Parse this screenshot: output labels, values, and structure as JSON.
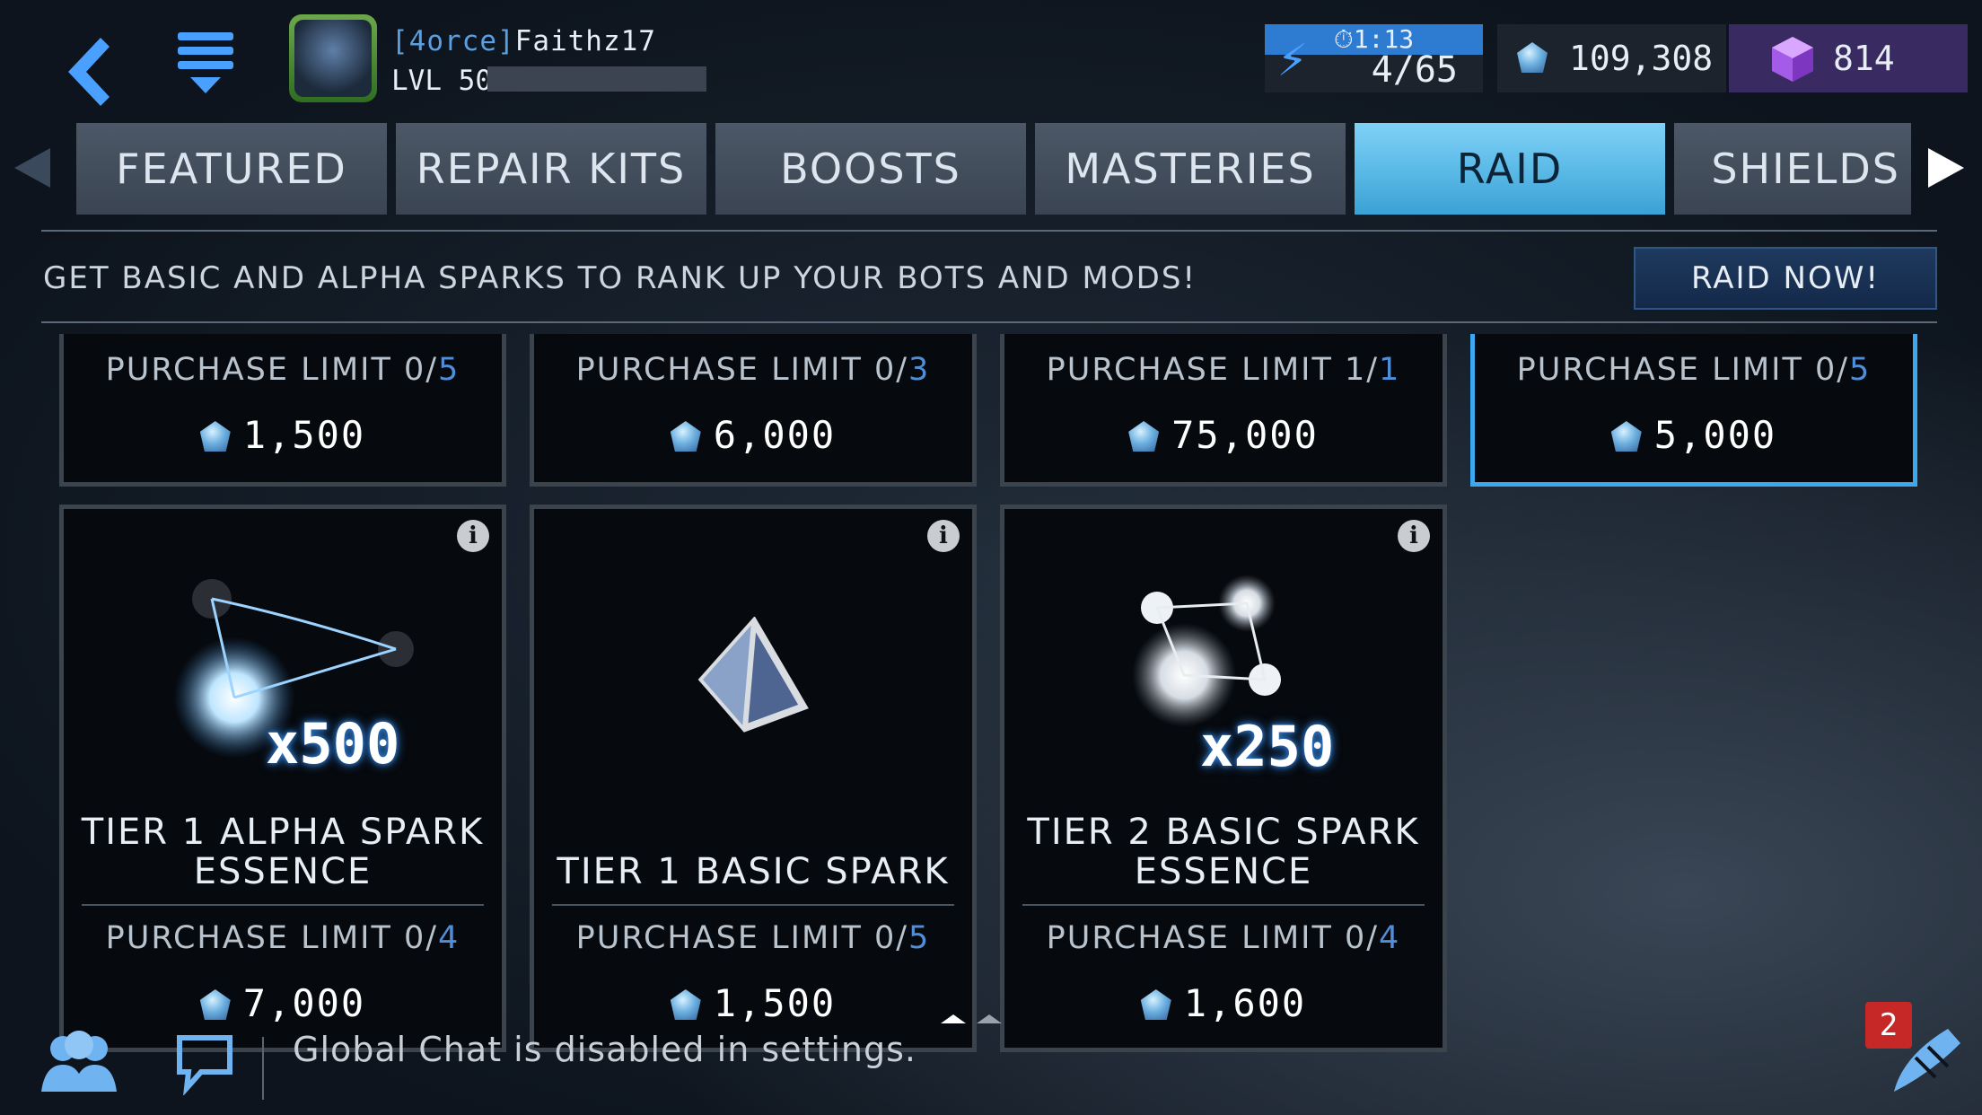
{
  "header": {
    "clan_tag": "[4orce]",
    "player_name": "Faithz17",
    "level": "LVL 50",
    "energy_timer": "1:13",
    "energy": "4/65",
    "crystals": "109,308",
    "gems": "814"
  },
  "tabs": [
    {
      "label": "FEATURED"
    },
    {
      "label": "REPAIR KITS"
    },
    {
      "label": "BOOSTS"
    },
    {
      "label": "MASTERIES"
    },
    {
      "label": "RAID",
      "active": true
    },
    {
      "label": "SHIELDS"
    }
  ],
  "banner": {
    "text": "GET BASIC AND ALPHA SPARKS TO RANK UP YOUR BOTS AND MODS!",
    "raid_button": "RAID NOW!"
  },
  "top_cards": [
    {
      "limit_prefix": "PURCHASE LIMIT 0/",
      "limit_max": "5",
      "price": "1,500"
    },
    {
      "limit_prefix": "PURCHASE LIMIT 0/",
      "limit_max": "3",
      "price": "6,000"
    },
    {
      "limit_prefix": "PURCHASE LIMIT 1/",
      "limit_max": "1",
      "price": "75,000"
    },
    {
      "limit_prefix": "PURCHASE LIMIT 0/",
      "limit_max": "5",
      "price": "5,000",
      "selected": true
    }
  ],
  "items": [
    {
      "title_line1": "TIER 1 ALPHA SPARK",
      "title_line2": "ESSENCE",
      "quantity": "x500",
      "limit_prefix": "PURCHASE LIMIT 0/",
      "limit_max": "4",
      "price": "7,000",
      "icon": "alpha-spark-essence-icon"
    },
    {
      "title_line1": "",
      "title_line2": "TIER 1 BASIC SPARK",
      "quantity": "",
      "limit_prefix": "PURCHASE LIMIT 0/",
      "limit_max": "5",
      "price": "1,500",
      "icon": "basic-spark-icon"
    },
    {
      "title_line1": "TIER 2 BASIC SPARK",
      "title_line2": "ESSENCE",
      "quantity": "x250",
      "limit_prefix": "PURCHASE LIMIT 0/",
      "limit_max": "4",
      "price": "1,600",
      "icon": "basic-spark-essence-icon"
    }
  ],
  "chat": {
    "message": "Global Chat is disabled in settings.",
    "notification_count": "2"
  },
  "colors": {
    "active_tab": "#3aa2d6",
    "limit_max": "#4f8ed8",
    "selected_border": "#3ba8f0",
    "badge": "#c62828"
  }
}
